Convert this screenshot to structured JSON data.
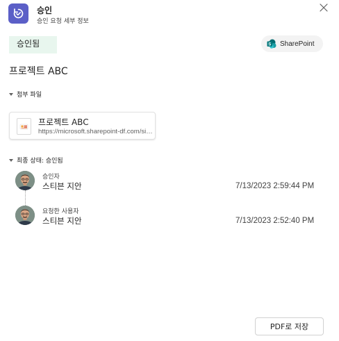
{
  "header": {
    "title": "승인",
    "subtitle": "승인 요청 세부 정보",
    "app_icon": "approvals-icon",
    "close_icon": "close-icon"
  },
  "status": {
    "label": "승인됨",
    "color": "#e8f6ee"
  },
  "sharepoint": {
    "label": "SharePoint",
    "icon": "sharepoint-icon"
  },
  "request": {
    "title": "프로젝트 ABC"
  },
  "attachments": {
    "heading": "첨부 파일",
    "file": {
      "name": "프로젝트 ABC",
      "url": "https://microsoft.sharepoint-df.com/sites/ProjectABC",
      "icon": "presentation-file-icon"
    }
  },
  "final_status": {
    "heading": "최종 상태: 승인됨",
    "entries": [
      {
        "role": "승인자",
        "name": "스티븐 지안",
        "time": "7/13/2023 2:59:44 PM"
      },
      {
        "role": "요청한 사용자",
        "name": "스티븐 지안",
        "time": "7/13/2023 2:52:40 PM"
      }
    ]
  },
  "footer": {
    "pdf_button": "PDF로 저장"
  },
  "colors": {
    "accent": "#5b5fc7",
    "approved_bg": "#e8f6ee",
    "sharepoint": "#038387"
  }
}
